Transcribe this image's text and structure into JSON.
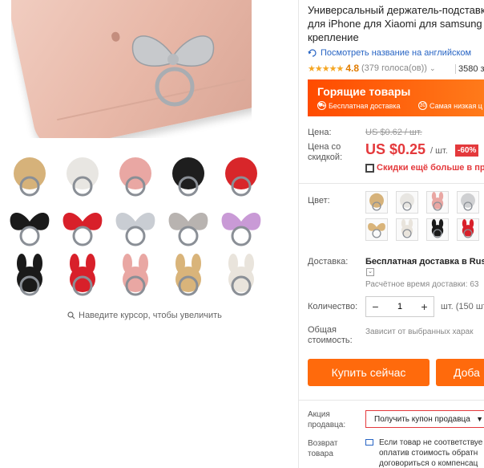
{
  "product": {
    "title": "Универсальный держатель-подставка\nдля iPhone для Xiaomi для samsung с\nкрепление",
    "translate_link": "Посмотреть название на английском",
    "stars": "★★★★★",
    "rating": "4.8",
    "votes": "(379 голоса(ов))",
    "orders": "3580 з"
  },
  "hot_deals": {
    "title": "Горящие товары",
    "free_shipping": "Бесплатная доставка",
    "day_low": "Самая низкая ц"
  },
  "price": {
    "price_label": "Цена:",
    "old_price": "US $0.62 / шт.",
    "discount_label": "Цена со\nскидкой:",
    "new_price": "US $0.25",
    "unit": "/ шт.",
    "discount": "-60%",
    "more_discount": "Скидки ещё больше в прил"
  },
  "options": {
    "color_label": "Цвет:",
    "shipping_label": "Доставка:",
    "shipping_value": "Бесплатная доставка в Russi",
    "shipping_time": "Расчётное время доставки: 63",
    "quantity_label": "Количество:",
    "quantity_value": "1",
    "quantity_minus": "−",
    "quantity_plus": "+",
    "quantity_unit": "шт. (150 шт",
    "total_label": "Общая\nстоимость:",
    "total_value": "Зависит от выбранных харак"
  },
  "actions": {
    "buy_now": "Купить сейчас",
    "add_to_cart": "Доба"
  },
  "seller": {
    "promo_label": "Акция\nпродавца:",
    "coupon": "Получить купон продавца",
    "return_label": "Возврат\nтовара",
    "return_text": "Если товар не соответствуе\nоплатив стоимость обратн\nдоговориться о компенсац"
  },
  "gallery": {
    "zoom_hint": "Наведите курсор, чтобы увеличить"
  },
  "colors": {
    "accent": "#ff6a0c",
    "price_red": "#e4393c",
    "link_blue": "#2764c4",
    "star": "#f5a623"
  }
}
